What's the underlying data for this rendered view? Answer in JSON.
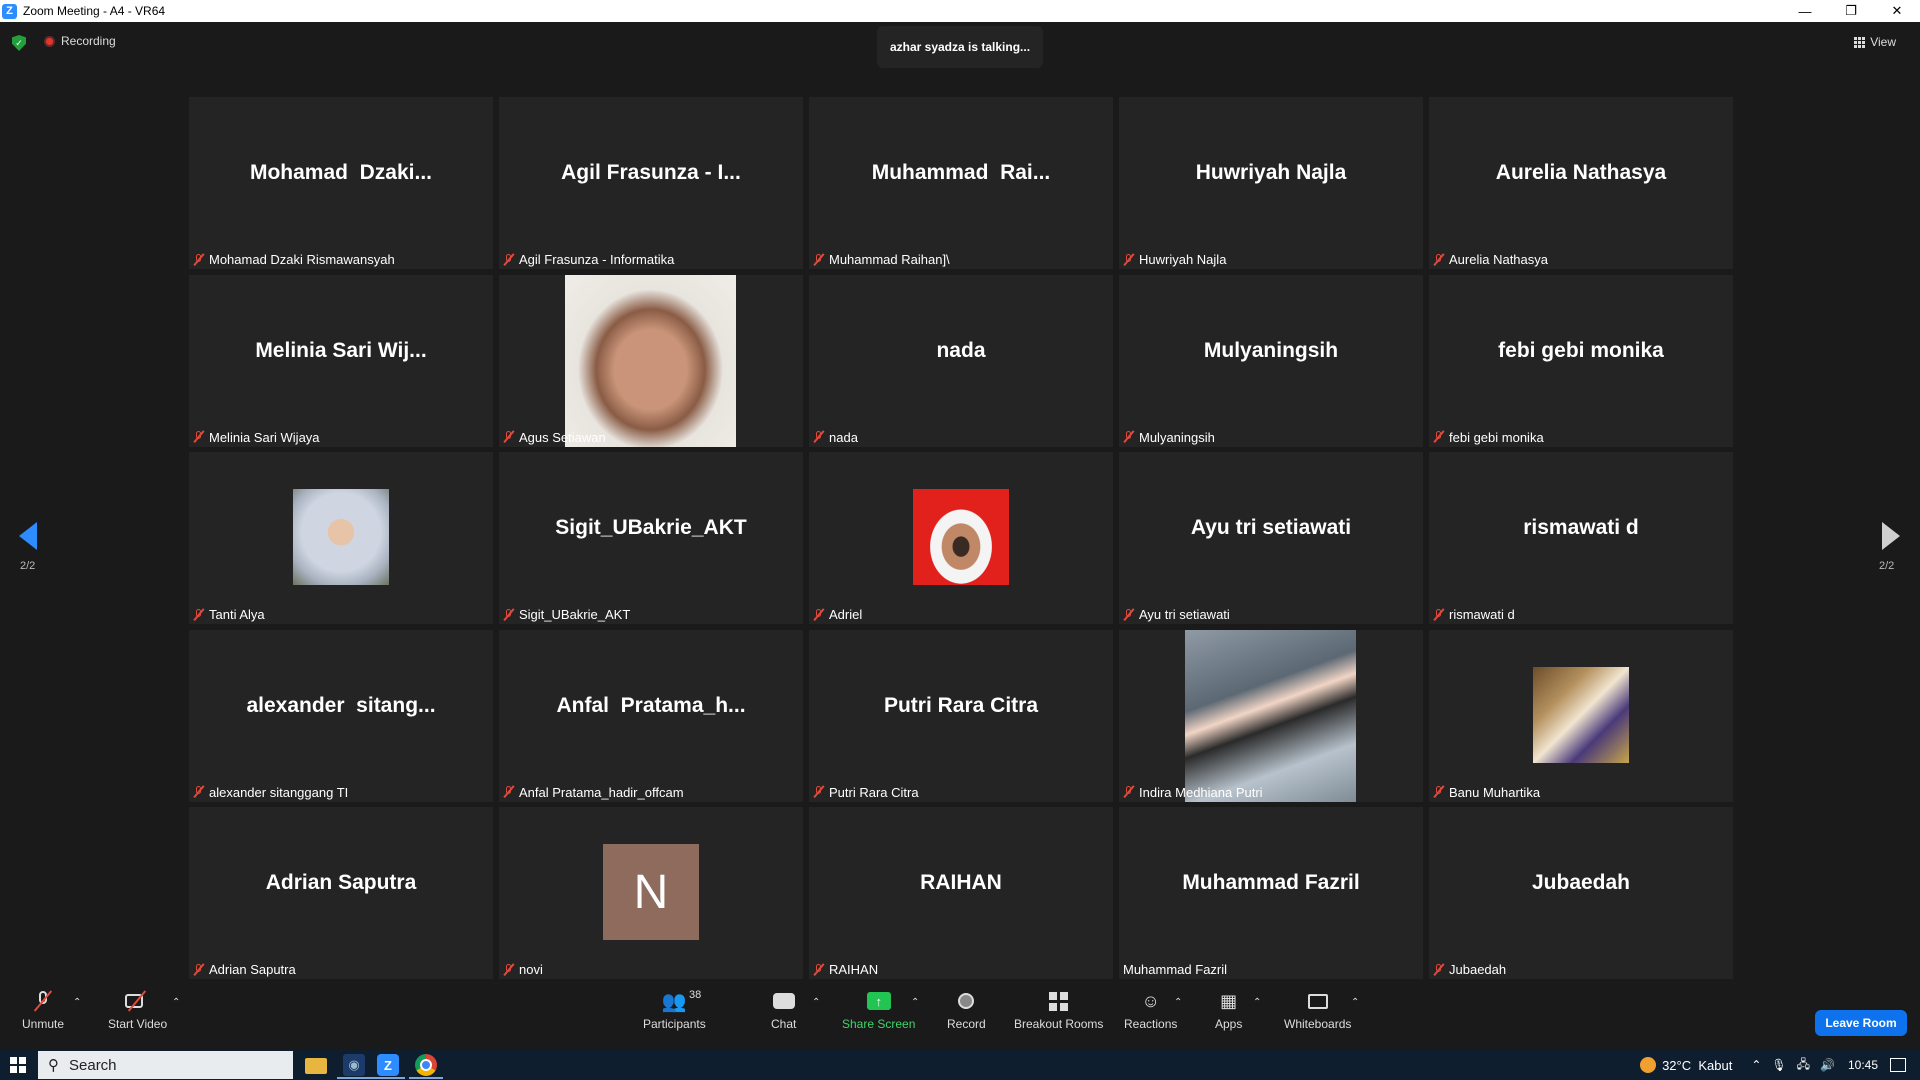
{
  "window": {
    "title": "Zoom Meeting - A4 - VR64"
  },
  "topbar": {
    "recording": "Recording",
    "talking": "azhar syadza is talking...",
    "view": "View"
  },
  "pager": {
    "left": "2/2",
    "right": "2/2"
  },
  "tiles": [
    {
      "display": "Mohamad  Dzaki...",
      "label": "Mohamad Dzaki Rismawansyah",
      "muted": true,
      "media": "none"
    },
    {
      "display": "Agil Frasunza - I...",
      "label": "Agil Frasunza - Informatika",
      "muted": true,
      "media": "none"
    },
    {
      "display": "Muhammad  Rai...",
      "label": "Muhammad Raihan]\\",
      "muted": true,
      "media": "none"
    },
    {
      "display": "Huwriyah Najla",
      "label": "Huwriyah Najla",
      "muted": true,
      "media": "none"
    },
    {
      "display": "Aurelia Nathasya",
      "label": "Aurelia Nathasya",
      "muted": true,
      "media": "none"
    },
    {
      "display": "Melinia Sari Wij...",
      "label": "Melinia Sari Wijaya",
      "muted": true,
      "media": "none"
    },
    {
      "display": "",
      "label": "Agus Setiawan",
      "muted": true,
      "media": "video"
    },
    {
      "display": "nada",
      "label": "nada",
      "muted": true,
      "media": "none"
    },
    {
      "display": "Mulyaningsih",
      "label": "Mulyaningsih",
      "muted": true,
      "media": "none"
    },
    {
      "display": "febi gebi monika",
      "label": "febi gebi monika",
      "muted": true,
      "media": "none"
    },
    {
      "display": "",
      "label": "Tanti Alya",
      "muted": true,
      "media": "photo"
    },
    {
      "display": "Sigit_UBakrie_AKT",
      "label": "Sigit_UBakrie_AKT",
      "muted": true,
      "media": "none"
    },
    {
      "display": "",
      "label": "Adriel",
      "muted": true,
      "media": "photo"
    },
    {
      "display": "Ayu tri setiawati",
      "label": "Ayu tri setiawati",
      "muted": true,
      "media": "none"
    },
    {
      "display": "rismawati d",
      "label": "rismawati d",
      "muted": true,
      "media": "none"
    },
    {
      "display": "alexander  sitang...",
      "label": "alexander sitanggang TI",
      "muted": true,
      "media": "none"
    },
    {
      "display": "Anfal  Pratama_h...",
      "label": "Anfal Pratama_hadir_offcam",
      "muted": true,
      "media": "none"
    },
    {
      "display": "Putri Rara Citra",
      "label": "Putri Rara Citra",
      "muted": true,
      "media": "none"
    },
    {
      "display": "",
      "label": "Indira Medhiana Putri",
      "muted": true,
      "media": "video"
    },
    {
      "display": "",
      "label": "Banu Muhartika",
      "muted": true,
      "media": "photo"
    },
    {
      "display": "Adrian Saputra",
      "label": "Adrian Saputra",
      "muted": true,
      "media": "none"
    },
    {
      "display": "N",
      "label": "novi",
      "muted": true,
      "media": "avatar"
    },
    {
      "display": "RAIHAN",
      "label": "RAIHAN",
      "muted": true,
      "media": "none"
    },
    {
      "display": "Muhammad Fazril",
      "label": "Muhammad Fazril",
      "muted": false,
      "media": "none"
    },
    {
      "display": "Jubaedah",
      "label": "Jubaedah",
      "muted": true,
      "media": "none"
    }
  ],
  "toolbar": {
    "unmute": "Unmute",
    "start_video": "Start Video",
    "participants": "Participants",
    "participants_count": "38",
    "chat": "Chat",
    "share_screen": "Share Screen",
    "record": "Record",
    "breakout_rooms": "Breakout Rooms",
    "reactions": "Reactions",
    "apps": "Apps",
    "whiteboards": "Whiteboards",
    "leave": "Leave Room"
  },
  "taskbar": {
    "search": "Search",
    "weather": "32°C  Kabut",
    "time": "10:45"
  }
}
